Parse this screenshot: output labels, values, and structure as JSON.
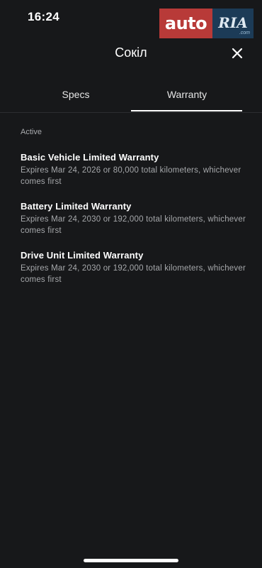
{
  "status_bar": {
    "time": "16:24"
  },
  "logo": {
    "left_text": "auto",
    "right_text": "RIA",
    "suffix": ".com"
  },
  "header": {
    "title": "Сокіл",
    "close_icon": "close-icon"
  },
  "tabs": [
    {
      "label": "Specs",
      "active": false
    },
    {
      "label": "Warranty",
      "active": true
    }
  ],
  "section": {
    "label": "Active"
  },
  "warranties": [
    {
      "title": "Basic Vehicle Limited Warranty",
      "description": "Expires Mar 24, 2026 or 80,000 total kilometers, whichever comes first"
    },
    {
      "title": "Battery Limited Warranty",
      "description": "Expires Mar 24, 2030 or 192,000 total kilometers, whichever comes first"
    },
    {
      "title": "Drive Unit Limited Warranty",
      "description": "Expires Mar 24, 2030 or 192,000 total kilometers, whichever comes first"
    }
  ],
  "colors": {
    "background": "#17181a",
    "text": "#ffffff",
    "muted": "#a6a8ab",
    "logo_red": "#b83a38",
    "logo_blue": "#1c3b57"
  }
}
